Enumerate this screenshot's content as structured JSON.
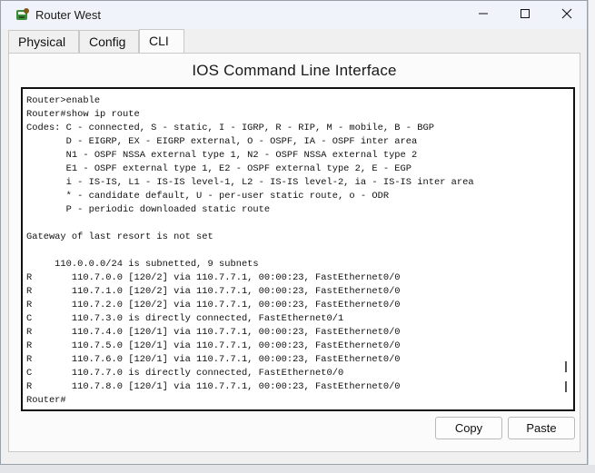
{
  "window": {
    "title": "Router West"
  },
  "tabs": [
    {
      "label": "Physical",
      "active": false
    },
    {
      "label": "Config",
      "active": false
    },
    {
      "label": "CLI",
      "active": true
    }
  ],
  "panel": {
    "title": "IOS Command Line Interface"
  },
  "terminal": {
    "lines": [
      "Router>enable",
      "Router#show ip route",
      "Codes: C - connected, S - static, I - IGRP, R - RIP, M - mobile, B - BGP",
      "       D - EIGRP, EX - EIGRP external, O - OSPF, IA - OSPF inter area",
      "       N1 - OSPF NSSA external type 1, N2 - OSPF NSSA external type 2",
      "       E1 - OSPF external type 1, E2 - OSPF external type 2, E - EGP",
      "       i - IS-IS, L1 - IS-IS level-1, L2 - IS-IS level-2, ia - IS-IS inter area",
      "       * - candidate default, U - per-user static route, o - ODR",
      "       P - periodic downloaded static route",
      "",
      "Gateway of last resort is not set",
      "",
      "     110.0.0.0/24 is subnetted, 9 subnets",
      "R       110.7.0.0 [120/2] via 110.7.7.1, 00:00:23, FastEthernet0/0",
      "R       110.7.1.0 [120/2] via 110.7.7.1, 00:00:23, FastEthernet0/0",
      "R       110.7.2.0 [120/2] via 110.7.7.1, 00:00:23, FastEthernet0/0",
      "C       110.7.3.0 is directly connected, FastEthernet0/1",
      "R       110.7.4.0 [120/1] via 110.7.7.1, 00:00:23, FastEthernet0/0",
      "R       110.7.5.0 [120/1] via 110.7.7.1, 00:00:23, FastEthernet0/0",
      "R       110.7.6.0 [120/1] via 110.7.7.1, 00:00:23, FastEthernet0/0",
      "C       110.7.7.0 is directly connected, FastEthernet0/0",
      "R       110.7.8.0 [120/1] via 110.7.7.1, 00:00:23, FastEthernet0/0",
      "Router#"
    ]
  },
  "buttons": {
    "copy": "Copy",
    "paste": "Paste"
  },
  "icons": {
    "app": "router-app-icon",
    "minimize": "minimize-icon",
    "maximize": "maximize-icon",
    "close": "close-icon"
  },
  "colors": {
    "titlebar": "#f0f3f9",
    "terminal_bg": "#ffffff",
    "terminal_border": "#111111"
  }
}
